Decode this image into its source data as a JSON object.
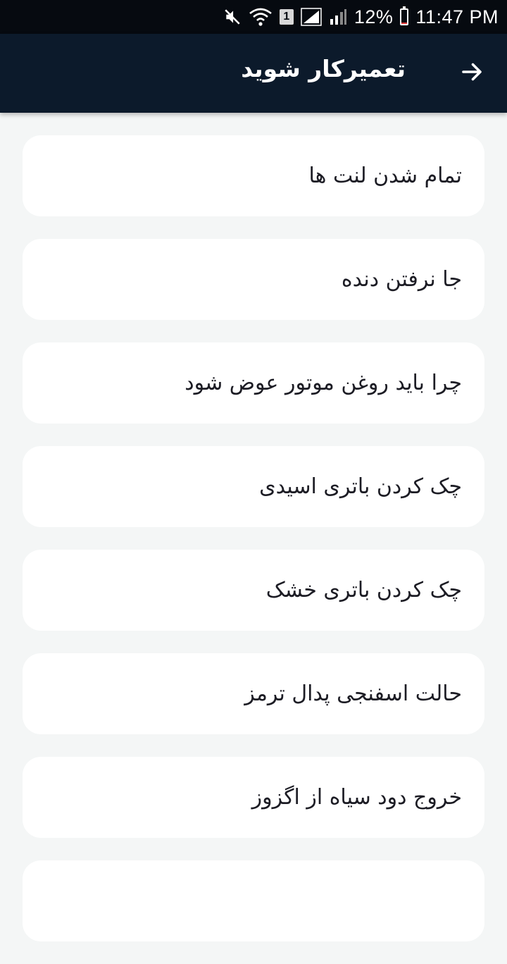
{
  "status_bar": {
    "sim_badge": "1",
    "battery_percent": "12%",
    "battery_level": 0.12,
    "time": "11:47 PM"
  },
  "app_bar": {
    "title": "تعمیرکار شوید",
    "back_icon": "arrow-right-icon"
  },
  "colors": {
    "app_bar_bg": "#0c1a2b",
    "status_bar_bg": "#060a10",
    "page_bg": "#f4f6f6",
    "card_bg": "#ffffff",
    "card_text": "#1c1c24"
  },
  "list": {
    "items": [
      {
        "label": "تمام شدن لنت ها"
      },
      {
        "label": "جا نرفتن دنده"
      },
      {
        "label": "چرا باید روغن موتور عوض شود"
      },
      {
        "label": "چک کردن باتری اسیدی"
      },
      {
        "label": "چک کردن باتری خشک"
      },
      {
        "label": "حالت اسفنجی پدال ترمز"
      },
      {
        "label": "خروج دود سیاه از اگزوز"
      }
    ]
  }
}
